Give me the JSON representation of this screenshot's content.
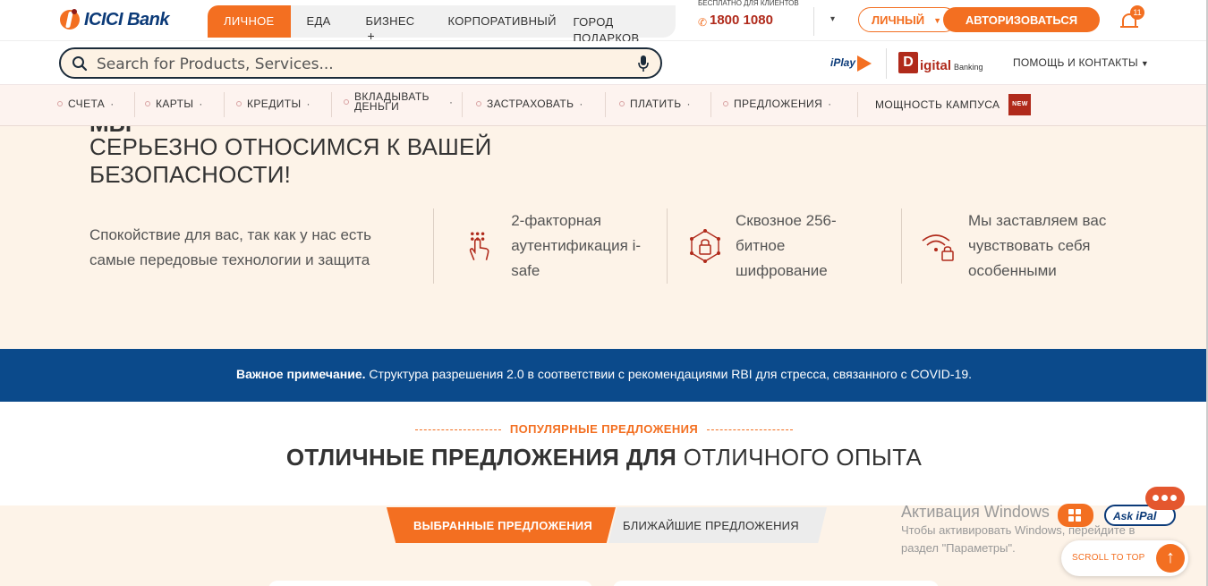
{
  "brand": {
    "name": "ICICI Bank"
  },
  "header": {
    "tabs": [
      {
        "label": "ЛИЧНОЕ",
        "active": true
      },
      {
        "label": "ЕДА"
      },
      {
        "label": "БИЗНЕС",
        "extra": "+"
      },
      {
        "label": "КОРПОРАТИВНЫЙ"
      },
      {
        "label": "ГОРОД ПОДАРКОВ"
      }
    ],
    "helpline": {
      "label": "БЕСПЛАТНО ДЛЯ КЛИЕНТОВ НЕТ.",
      "number": "1800 1080"
    },
    "personal_pill": "ЛИЧНЫЙ",
    "login_button": "АВТОРИЗОВАТЬСЯ",
    "notifications": "11"
  },
  "search": {
    "placeholder": "Search for Products, Services..."
  },
  "partners": {
    "iplay": "iPlay",
    "digital_d": "D",
    "digital_big": "igital",
    "digital_small": "Banking"
  },
  "help": {
    "label": "ПОМОЩЬ И КОНТАКТЫ"
  },
  "nav": {
    "items": [
      "СЧЕТА",
      "КАРТЫ",
      "КРЕДИТЫ",
      "ВКЛАДЫВАТЬ ДЕНЬГИ",
      "ЗАСТРАХОВАТЬ",
      "ПЛАТИТЬ",
      "ПРЕДЛОЖЕНИЯ",
      "МОЩНОСТЬ КАМПУСА"
    ],
    "new_badge": "NEW"
  },
  "security": {
    "title_cut": "МЫ",
    "title_line1": "СЕРЬЕЗНО ОТНОСИМСЯ К ВАШЕЙ",
    "title_line2": "БЕЗОПАСНОСТИ!",
    "description": "Спокойствие для вас, так как у нас есть самые передовые технологии и защита",
    "features": [
      {
        "icon": "fingerprint-touch-icon",
        "text": "2-факторная аутентификация i-safe"
      },
      {
        "icon": "encryption-lock-network-icon",
        "text": "Сквозное 256-битное шифрование"
      },
      {
        "icon": "wifi-lock-icon",
        "text": "Мы заставляем вас чувствовать себя особенными"
      }
    ]
  },
  "notice": {
    "bold": "Важное примечание.",
    "text": " Структура разрешения 2.0 в соответствии с рекомендациями RBI для стресса, связанного с COVID-19."
  },
  "offers": {
    "subtitle": "ПОПУЛЯРНЫЕ ПРЕДЛОЖЕНИЯ",
    "title_bold": "ОТЛИЧНЫЕ ПРЕДЛОЖЕНИЯ ДЛЯ",
    "title_rest": " ОТЛИЧНОГО ОПЫТА",
    "tabs": [
      "ВЫБРАННЫЕ ПРЕДЛОЖЕНИЯ",
      "БЛИЖАЙШИЕ ПРЕДЛОЖЕНИЯ"
    ]
  },
  "watermark": {
    "heading": "Активация Windows",
    "line1": "Чтобы активировать Windows, перейдите в",
    "line2": "раздел \"Параметры\"."
  },
  "widgets": {
    "ask": "Ask",
    "ipal": "iPal",
    "scroll_top": "SCROLL TO TOP"
  },
  "colors": {
    "accent": "#f36f21",
    "brand_blue": "#0b3a78",
    "notice_bg": "#0b4a8b",
    "section_bg": "#fdf3e8"
  }
}
